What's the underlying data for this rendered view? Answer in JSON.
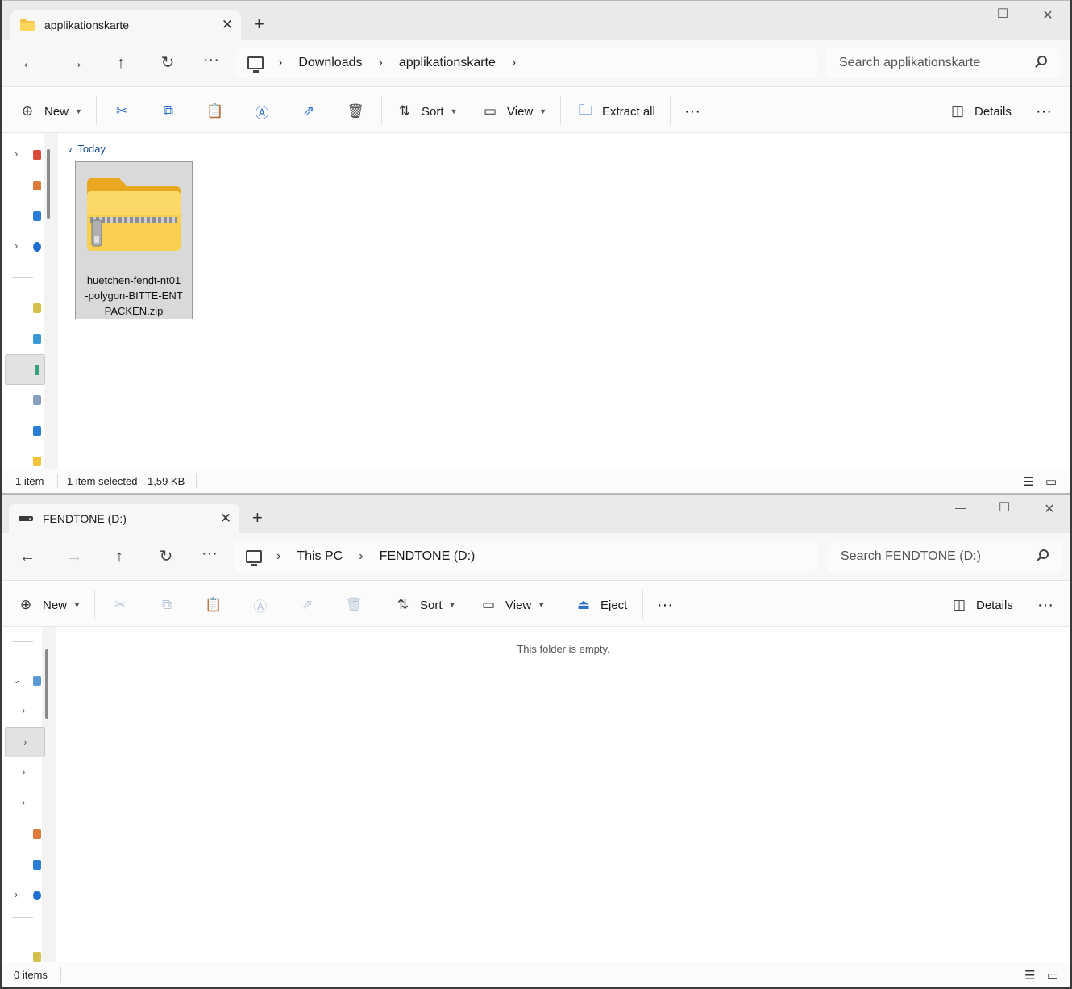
{
  "window1": {
    "tab_title": "applikationskarte",
    "tab_icon": "folder-icon",
    "breadcrumb": [
      "Downloads",
      "applikationskarte"
    ],
    "search_placeholder": "Search applikationskarte",
    "toolbar": {
      "new_label": "New",
      "sort_label": "Sort",
      "view_label": "View",
      "extract_label": "Extract all",
      "details_label": "Details"
    },
    "group_header": "Today",
    "file": {
      "name": "huetchen-fendt-nt01-polygon-BITTE-ENTPACKEN.zip",
      "name_lines": [
        "huetchen-fendt-nt01",
        "-polygon-BITTE-ENT",
        "PACKEN.zip"
      ],
      "icon": "zip-folder-icon"
    },
    "status": {
      "count": "1 item",
      "selected": "1 item selected",
      "size": "1,59 KB"
    }
  },
  "window2": {
    "tab_title": "FENDTONE (D:)",
    "tab_icon": "drive-icon",
    "breadcrumb": [
      "This PC",
      "FENDTONE (D:)"
    ],
    "search_placeholder": "Search FENDTONE (D:)",
    "toolbar": {
      "new_label": "New",
      "sort_label": "Sort",
      "view_label": "View",
      "eject_label": "Eject",
      "details_label": "Details"
    },
    "empty_message": "This folder is empty.",
    "status": {
      "count": "0 items"
    }
  },
  "colors": {
    "accent": "#2f6fd0",
    "zip_folder": "#f7c842",
    "selection": "#d9d9d9"
  }
}
